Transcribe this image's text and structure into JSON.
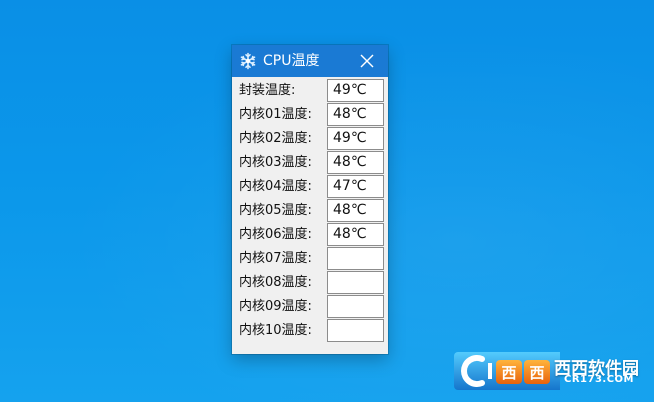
{
  "window": {
    "title": "CPU温度",
    "close_symbol": "✕"
  },
  "sensors": [
    {
      "label": "封装温度:",
      "value": "49℃"
    },
    {
      "label": "内核01温度:",
      "value": "48℃"
    },
    {
      "label": "内核02温度:",
      "value": "49℃"
    },
    {
      "label": "内核03温度:",
      "value": "48℃"
    },
    {
      "label": "内核04温度:",
      "value": "47℃"
    },
    {
      "label": "内核05温度:",
      "value": "48℃"
    },
    {
      "label": "内核06温度:",
      "value": "48℃"
    },
    {
      "label": "内核07温度:",
      "value": ""
    },
    {
      "label": "内核08温度:",
      "value": ""
    },
    {
      "label": "内核09温度:",
      "value": ""
    },
    {
      "label": "内核10温度:",
      "value": ""
    }
  ],
  "watermark": {
    "site_name": "西西软件园",
    "site_domain": "CR173.COM"
  },
  "colors": {
    "desktop": "#0b97ea",
    "titlebar": "#1a7ad4",
    "window_bg": "#f0f0f0",
    "field_border": "#8c8c8c"
  },
  "icons": {
    "app": "snowflake-icon",
    "close": "close-icon"
  }
}
